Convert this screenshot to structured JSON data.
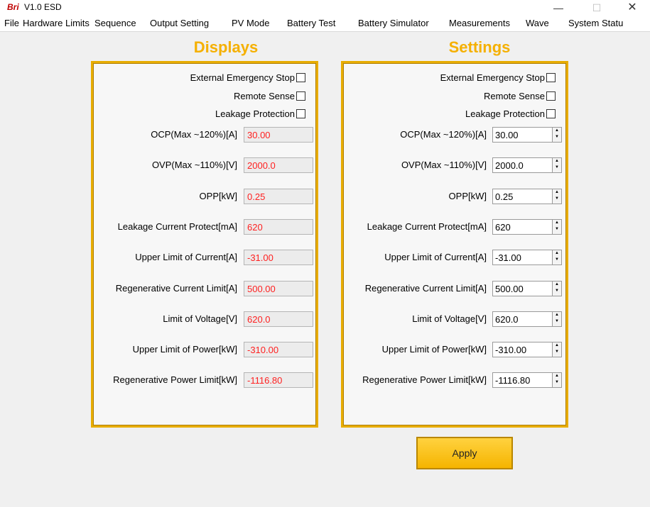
{
  "window": {
    "logo": "Bri",
    "title": "V1.0  ESD",
    "min_icon": "—",
    "max_icon": "☐",
    "close_icon": "✕"
  },
  "menu": [
    "File",
    "Hardware Limits",
    "Sequence",
    "Output Setting",
    "PV Mode",
    "Battery Test",
    "Battery Simulator",
    "Measurements",
    "Wave",
    "System Statu"
  ],
  "displays": {
    "heading": "Displays",
    "checks": [
      "External Emergency Stop",
      "Remote Sense",
      "Leakage Protection"
    ],
    "fields": [
      {
        "label": "OCP(Max ~120%)[A]",
        "value": "30.00"
      },
      {
        "label": "OVP(Max ~110%)[V]",
        "value": "2000.0"
      },
      {
        "label": "OPP[kW]",
        "value": "0.25"
      },
      {
        "label": "Leakage Current Protect[mA]",
        "value": "620"
      },
      {
        "label": "Upper Limit of Current[A]",
        "value": "-31.00"
      },
      {
        "label": "Regenerative Current Limit[A]",
        "value": "500.00"
      },
      {
        "label": "Limit of Voltage[V]",
        "value": "620.0"
      },
      {
        "label": "Upper Limit of Power[kW]",
        "value": "-310.00"
      },
      {
        "label": "Regenerative Power Limit[kW]",
        "value": "-1116.80"
      }
    ]
  },
  "settings": {
    "heading": "Settings",
    "checks": [
      "External Emergency Stop",
      "Remote Sense",
      "Leakage Protection"
    ],
    "fields": [
      {
        "label": "OCP(Max ~120%)[A]",
        "value": "30.00"
      },
      {
        "label": "OVP(Max ~110%)[V]",
        "value": "2000.0"
      },
      {
        "label": "OPP[kW]",
        "value": "0.25"
      },
      {
        "label": "Leakage Current Protect[mA]",
        "value": "620"
      },
      {
        "label": "Upper Limit of Current[A]",
        "value": "-31.00"
      },
      {
        "label": "Regenerative Current Limit[A]",
        "value": "500.00"
      },
      {
        "label": "Limit of Voltage[V]",
        "value": "620.0"
      },
      {
        "label": "Upper Limit of Power[kW]",
        "value": "-310.00"
      },
      {
        "label": "Regenerative Power Limit[kW]",
        "value": "-1116.80"
      }
    ]
  },
  "apply_label": "Apply",
  "colors": {
    "accent": "#f5b000",
    "display_value": "#ff2020"
  }
}
